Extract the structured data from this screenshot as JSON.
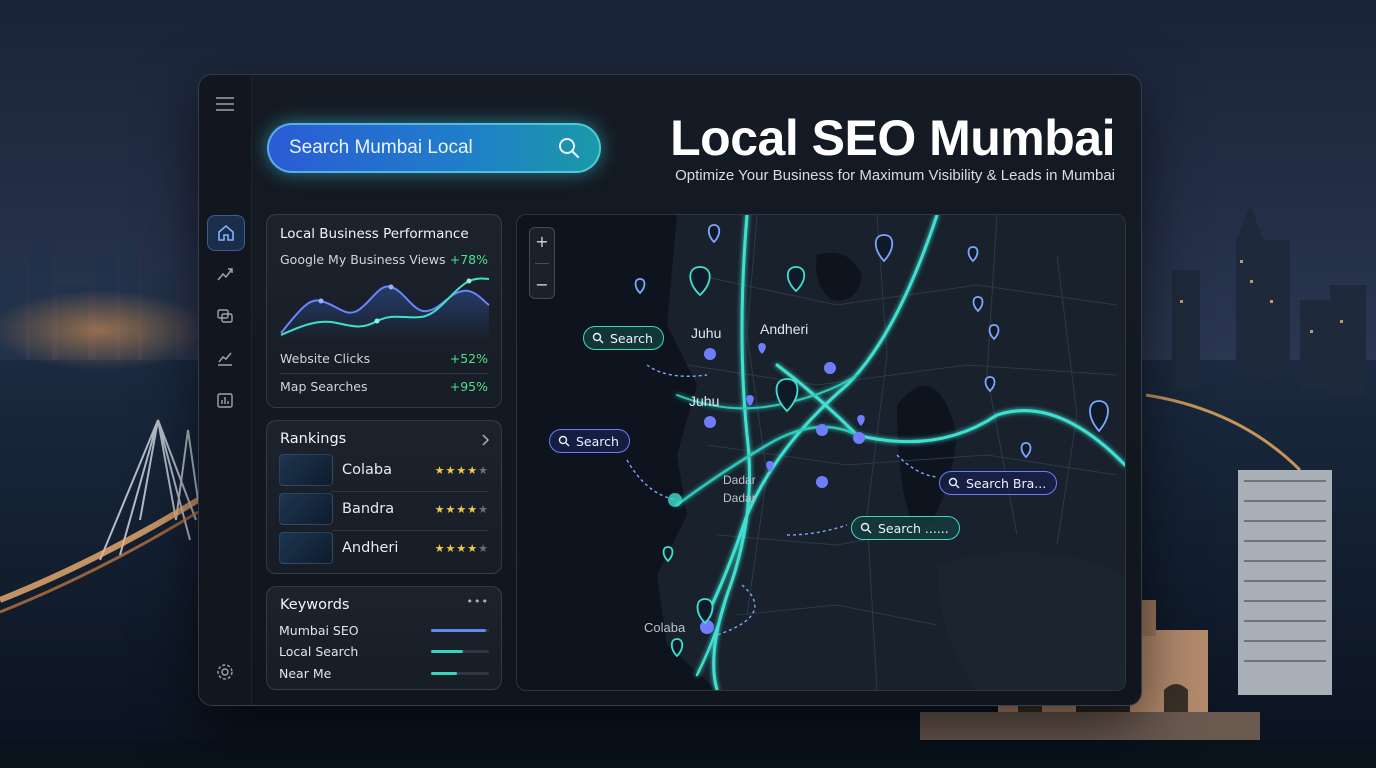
{
  "hero": {
    "title": "Local SEO Mumbai",
    "subtitle": "Optimize Your Business for Maximum Visibility & Leads in Mumbai"
  },
  "search": {
    "placeholder": "Search Mumbai Local"
  },
  "sidebar": {
    "items": [
      {
        "icon": "home-icon",
        "active": true
      },
      {
        "icon": "trend-icon",
        "active": false
      },
      {
        "icon": "chat-icon",
        "active": false
      },
      {
        "icon": "analytics-icon",
        "active": false
      },
      {
        "icon": "reports-icon",
        "active": false
      }
    ],
    "bottom_icon": "settings-icon"
  },
  "performance": {
    "title": "Local Business Performance",
    "metrics": [
      {
        "label": "Google My Business Views",
        "value": "+78%"
      },
      {
        "label": "Website Clicks",
        "value": "+52%"
      },
      {
        "label": "Map Searches",
        "value": "+95%"
      }
    ]
  },
  "rankings": {
    "title": "Rankings",
    "items": [
      {
        "name": "Colaba",
        "stars": 4
      },
      {
        "name": "Bandra",
        "stars": 4
      },
      {
        "name": "Andheri",
        "stars": 4
      }
    ]
  },
  "keywords": {
    "title": "Keywords",
    "more": "•••",
    "items": [
      {
        "name": "Mumbai SEO",
        "level": 0.95,
        "color": "#5b8df0"
      },
      {
        "name": "Local Search",
        "level": 0.55,
        "color": "#35d6c0"
      },
      {
        "name": "Near Me",
        "level": 0.45,
        "color": "#35d6c0"
      }
    ]
  },
  "map": {
    "zoom_in": "+",
    "zoom_out": "−",
    "labels": {
      "juhu_1": "Juhu",
      "juhu_2": "Juhu",
      "andheri": "Andheri",
      "dadar_1": "Dadar",
      "dadar_2": "Dadar",
      "colaba": "Colaba"
    },
    "chips": [
      {
        "text": "Search",
        "style": "teal"
      },
      {
        "text": "Search",
        "style": "blue"
      },
      {
        "text": "Search Bra...",
        "style": "blue"
      },
      {
        "text": "Search ......",
        "style": "teal"
      }
    ]
  },
  "colors": {
    "accent_teal": "#3fe0d0",
    "accent_blue": "#4a78f0",
    "positive": "#4ee08f",
    "star": "#f2c94c"
  }
}
